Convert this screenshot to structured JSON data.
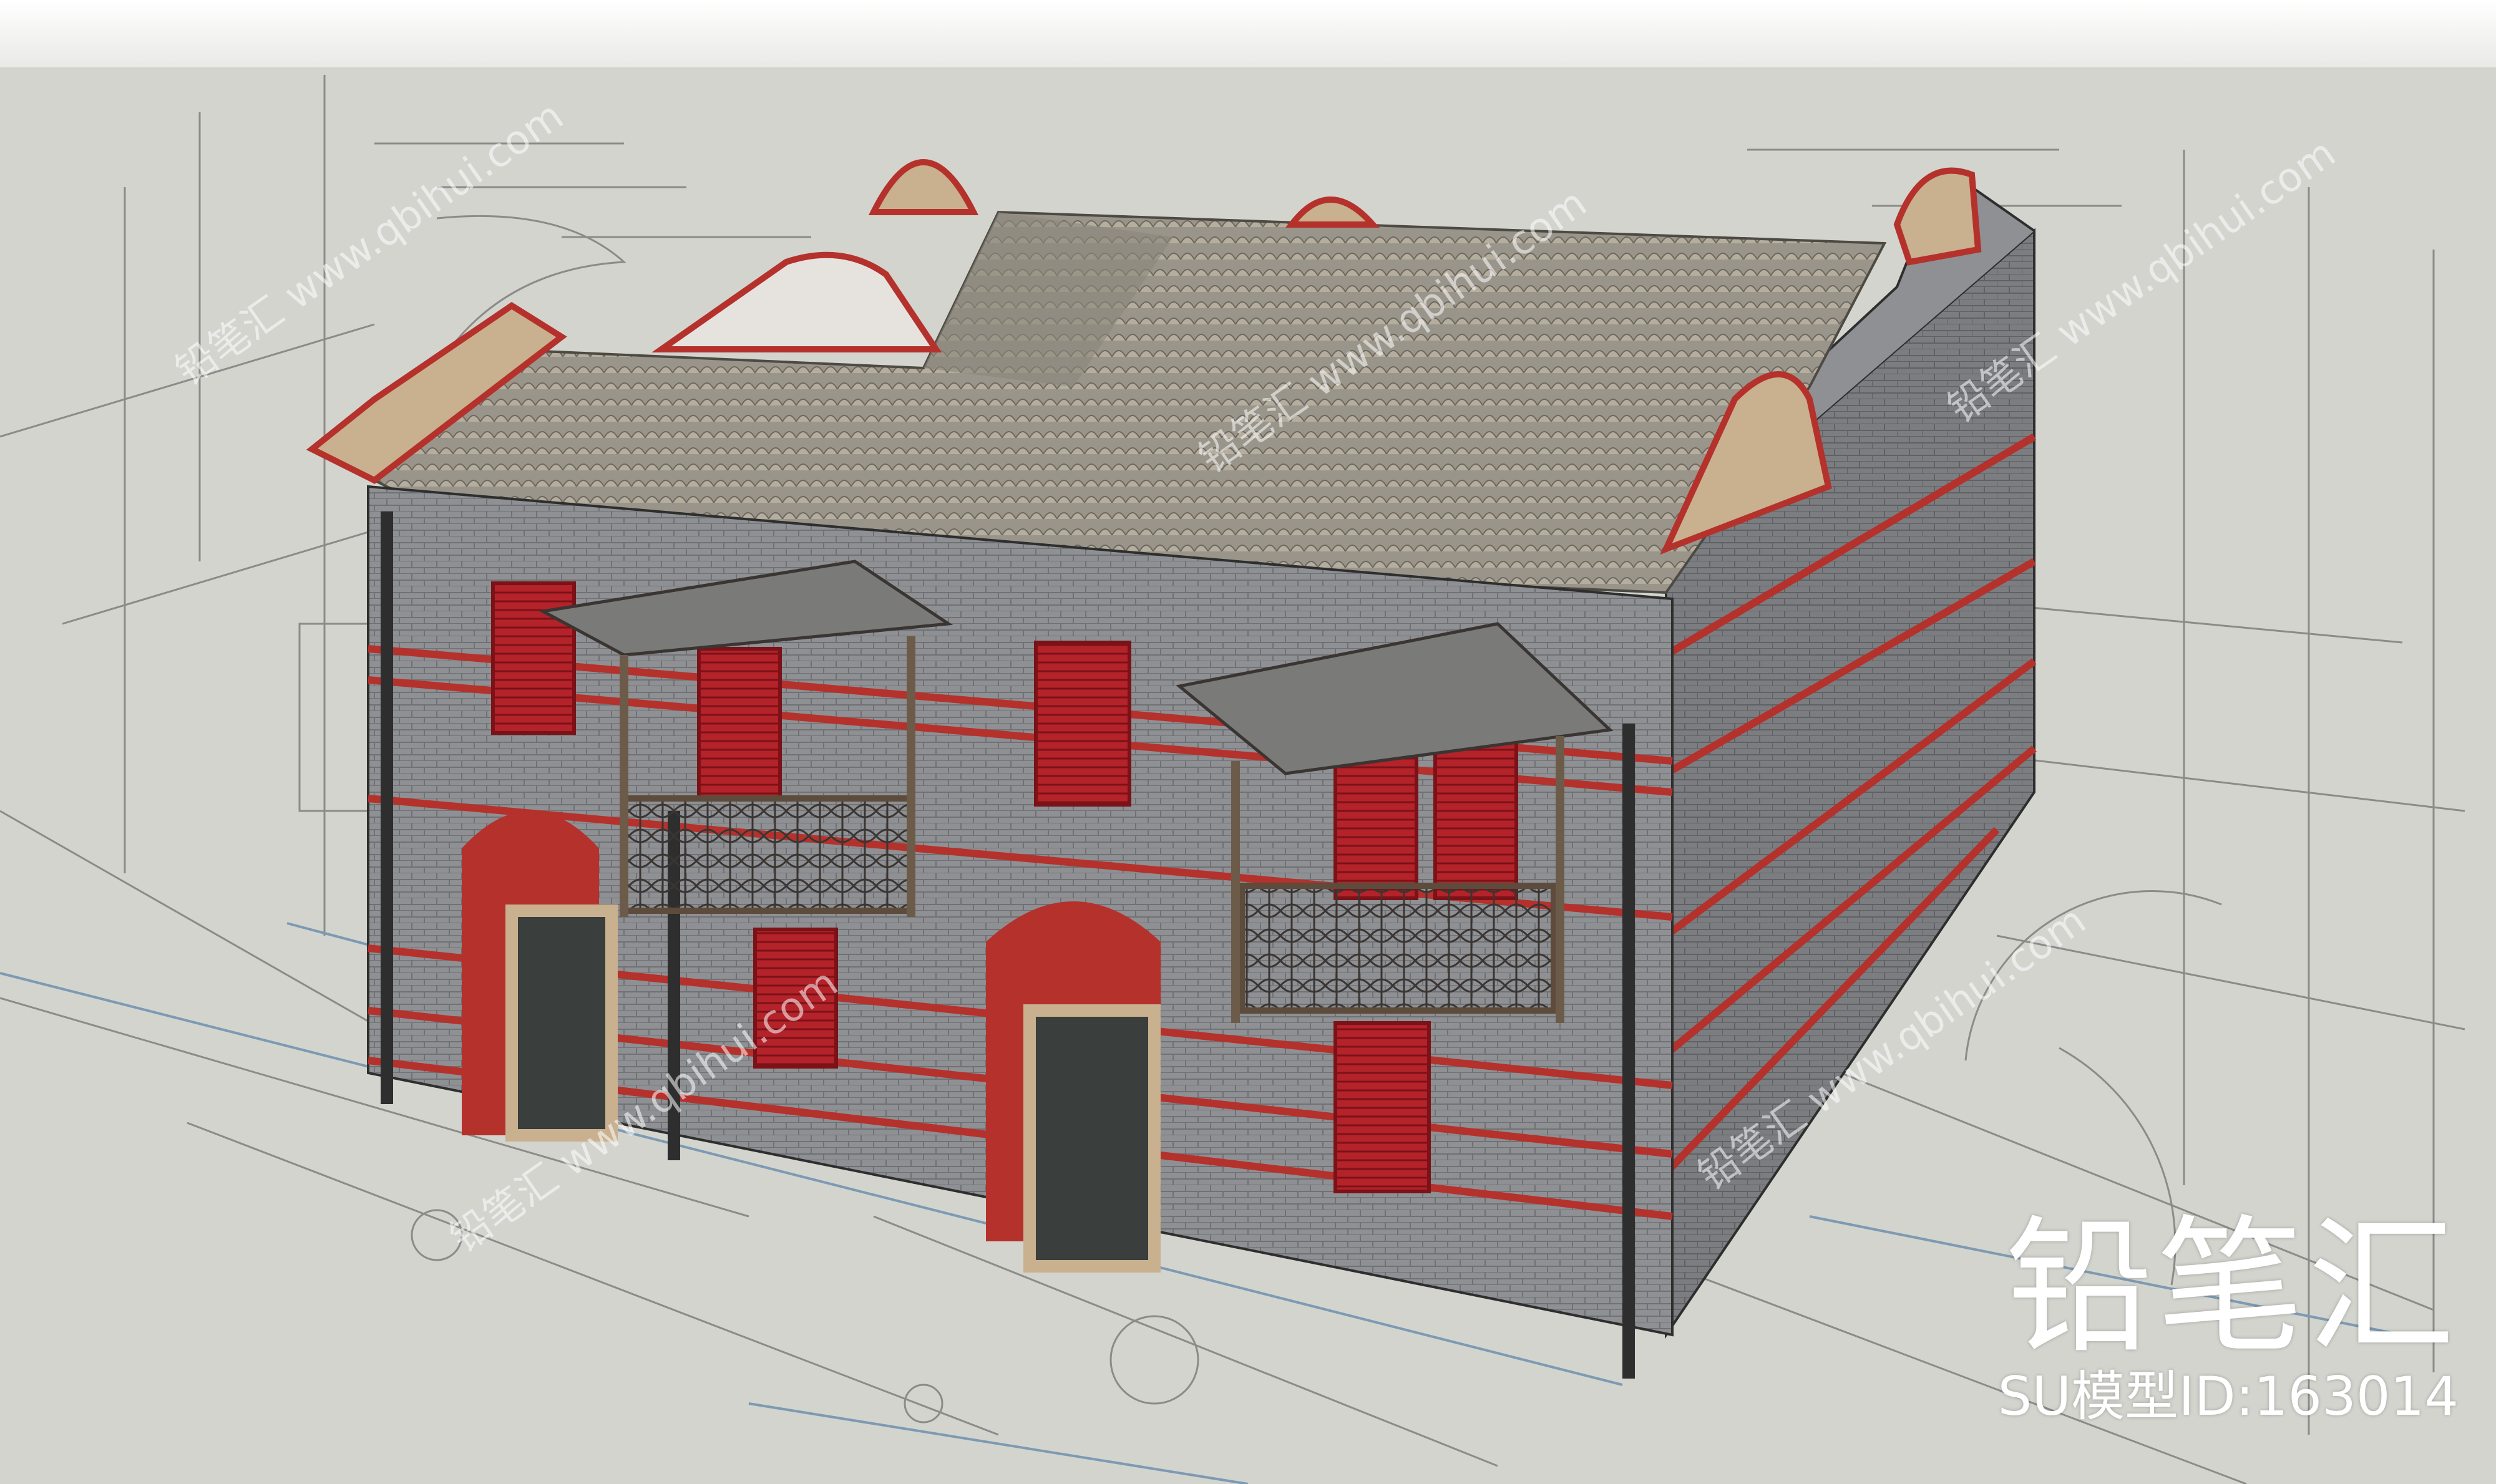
{
  "branding": {
    "logo_text": "铅笔汇",
    "model_id": "SU模型ID:163014"
  },
  "watermark": {
    "text": "铅笔汇 www.qbihui.com"
  },
  "colors": {
    "background": "#d3d4ce",
    "brick_gray": "#8d8f92",
    "brick_red": "#b5312c",
    "roof_tile": "#8e8a80",
    "shutter_red": "#b4222a",
    "trim_cream": "#c9b08e",
    "ironwork": "#3a3532"
  }
}
